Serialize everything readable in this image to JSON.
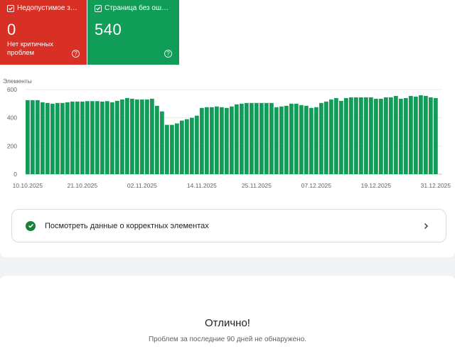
{
  "cards": {
    "invalid": {
      "label": "Недопустимое з…",
      "value": "0",
      "subtitle": "Нет критичных проблем",
      "color": "#d93025",
      "icon": "checkbox-checked-icon"
    },
    "valid": {
      "label": "Страница без ош…",
      "value": "540",
      "color": "#0f9d58",
      "icon": "checkbox-checked-icon"
    },
    "help_icon": "help-icon"
  },
  "chart_data": {
    "type": "bar",
    "ylabel": "Элементы",
    "ylim": [
      0,
      600
    ],
    "y_ticks": [
      "0",
      "200",
      "400",
      "600"
    ],
    "x_ticks": [
      "10.10.2025",
      "21.10.2025",
      "02.11.2025",
      "14.11.2025",
      "25.11.2025",
      "07.12.2025",
      "19.12.2025",
      "31.12.2025"
    ],
    "grid": true,
    "color": "#0f9d58",
    "values": [
      525,
      525,
      525,
      510,
      505,
      500,
      505,
      505,
      510,
      515,
      515,
      515,
      518,
      518,
      518,
      515,
      518,
      510,
      520,
      530,
      540,
      535,
      530,
      530,
      530,
      535,
      485,
      445,
      350,
      350,
      360,
      380,
      390,
      400,
      415,
      470,
      475,
      475,
      480,
      475,
      470,
      480,
      495,
      500,
      505,
      505,
      505,
      505,
      505,
      505,
      475,
      480,
      485,
      500,
      500,
      490,
      485,
      470,
      475,
      505,
      515,
      530,
      540,
      520,
      540,
      545,
      545,
      545,
      545,
      545,
      535,
      535,
      545,
      545,
      555,
      535,
      540,
      555,
      550,
      560,
      555,
      545,
      540
    ]
  },
  "link": {
    "label": "Посмотреть данные о корректных элементах",
    "icon": "check-circle-icon",
    "chevron": "chevron-right-icon"
  },
  "status": {
    "title": "Отлично!",
    "subtitle": "Проблем за последние 90 дней не обнаружено."
  }
}
